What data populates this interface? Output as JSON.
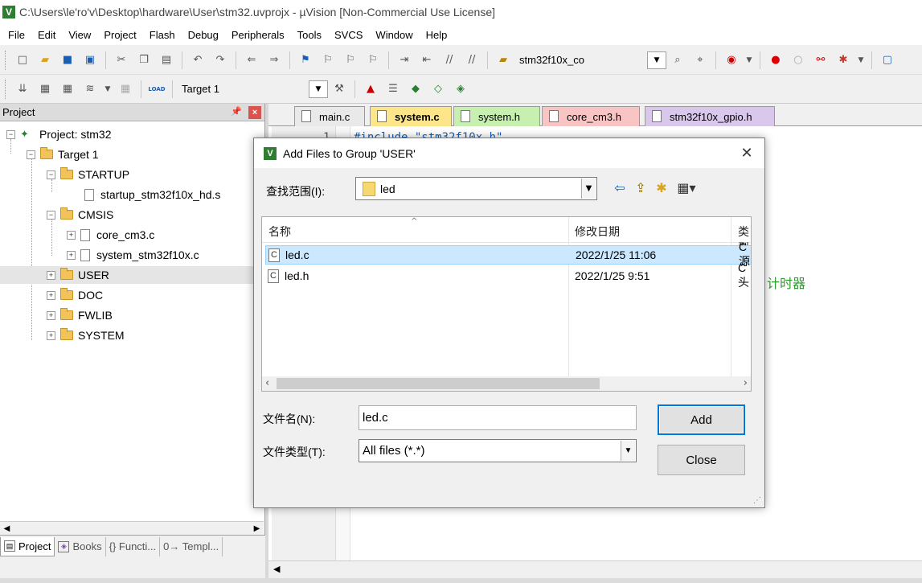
{
  "window": {
    "title": "C:\\Users\\le'ro'v\\Desktop\\hardware\\User\\stm32.uvprojx - µVision  [Non-Commercial Use License]",
    "app_icon": "V"
  },
  "menu": [
    "File",
    "Edit",
    "View",
    "Project",
    "Flash",
    "Debug",
    "Peripherals",
    "Tools",
    "SVCS",
    "Window",
    "Help"
  ],
  "toolbar1": {
    "device_label": "stm32f10x_co"
  },
  "toolbar2": {
    "target_label": "Target 1",
    "load_label": "LOAD"
  },
  "project_panel": {
    "title": "Project",
    "tree": {
      "root": "Project: stm32",
      "target": "Target 1",
      "startup": "STARTUP",
      "startup_file": "startup_stm32f10x_hd.s",
      "cmsis": "CMSIS",
      "cmsis_file1": "core_cm3.c",
      "cmsis_file2": "system_stm32f10x.c",
      "user": "USER",
      "doc": "DOC",
      "fwlib": "FWLIB",
      "system": "SYSTEM"
    },
    "bottom_tabs": [
      "Project",
      "Books",
      "{} Functi...",
      "0→ Templ..."
    ]
  },
  "editor": {
    "tabs": [
      {
        "label": "main.c",
        "color": "#e9e9e9"
      },
      {
        "label": "system.c",
        "color": "#fde68a"
      },
      {
        "label": "system.h",
        "color": "#c6efb0"
      },
      {
        "label": "core_cm3.h",
        "color": "#f9c4c4"
      },
      {
        "label": "stm32f10x_gpio.h",
        "color": "#d9c7ec"
      }
    ],
    "line_number": "1",
    "line_code": "#include \"stm32f10x.h\"",
    "comment_fragment": "计时器"
  },
  "dialog": {
    "title": "Add Files to Group 'USER'",
    "look_in_label": "查找范围(I):",
    "look_in_value": "led",
    "columns": [
      "名称",
      "修改日期",
      "类型"
    ],
    "files": [
      {
        "name": "led.c",
        "date": "2022/1/25 11:06",
        "type": "C 源",
        "selected": true
      },
      {
        "name": "led.h",
        "date": "2022/1/25 9:51",
        "type": "C 头",
        "selected": false
      }
    ],
    "filename_label": "文件名(N):",
    "filename_value": "led.c",
    "filetype_label": "文件类型(T):",
    "filetype_value": "All files (*.*)",
    "add_button": "Add",
    "close_button": "Close"
  }
}
